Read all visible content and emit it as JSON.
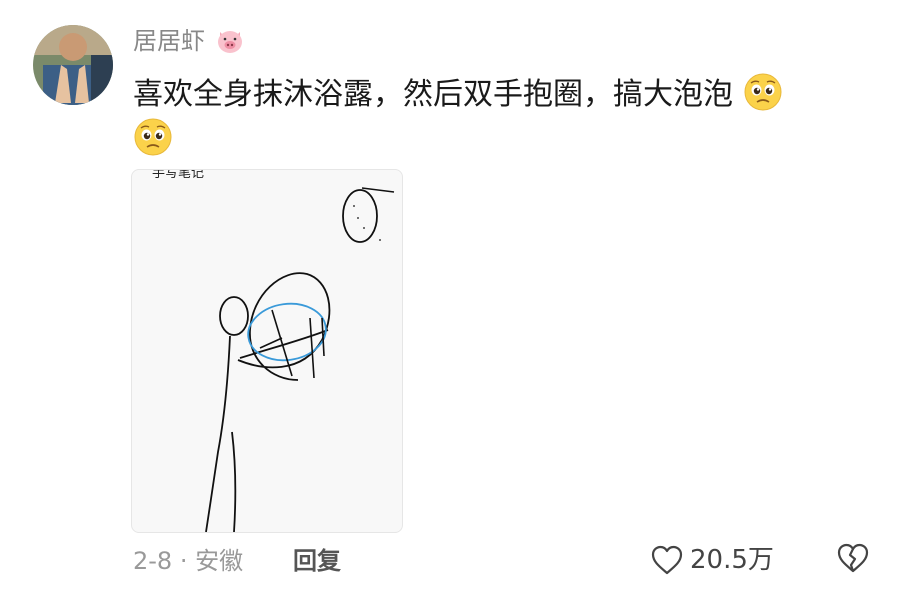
{
  "comment": {
    "username": "居居虾",
    "username_badge_icon": "pig-face-icon",
    "text": "喜欢全身抹沐浴露，然后双手抱圈，搞大泡泡",
    "trailing_emojis": [
      "pleading-face-icon",
      "pleading-face-icon"
    ],
    "image": {
      "header_text": "手写笔记"
    },
    "meta": {
      "date_location": "2-8 · 安徽",
      "reply_label": "回复"
    },
    "actions": {
      "like_icon": "heart-outline-icon",
      "like_count": "20.5万",
      "dislike_icon": "broken-heart-icon"
    }
  },
  "colors": {
    "username": "#888888",
    "body_text": "#1a1a1a",
    "meta": "#999999",
    "sketch_stroke": "#111111",
    "sketch_blue": "#3a9ad9"
  }
}
